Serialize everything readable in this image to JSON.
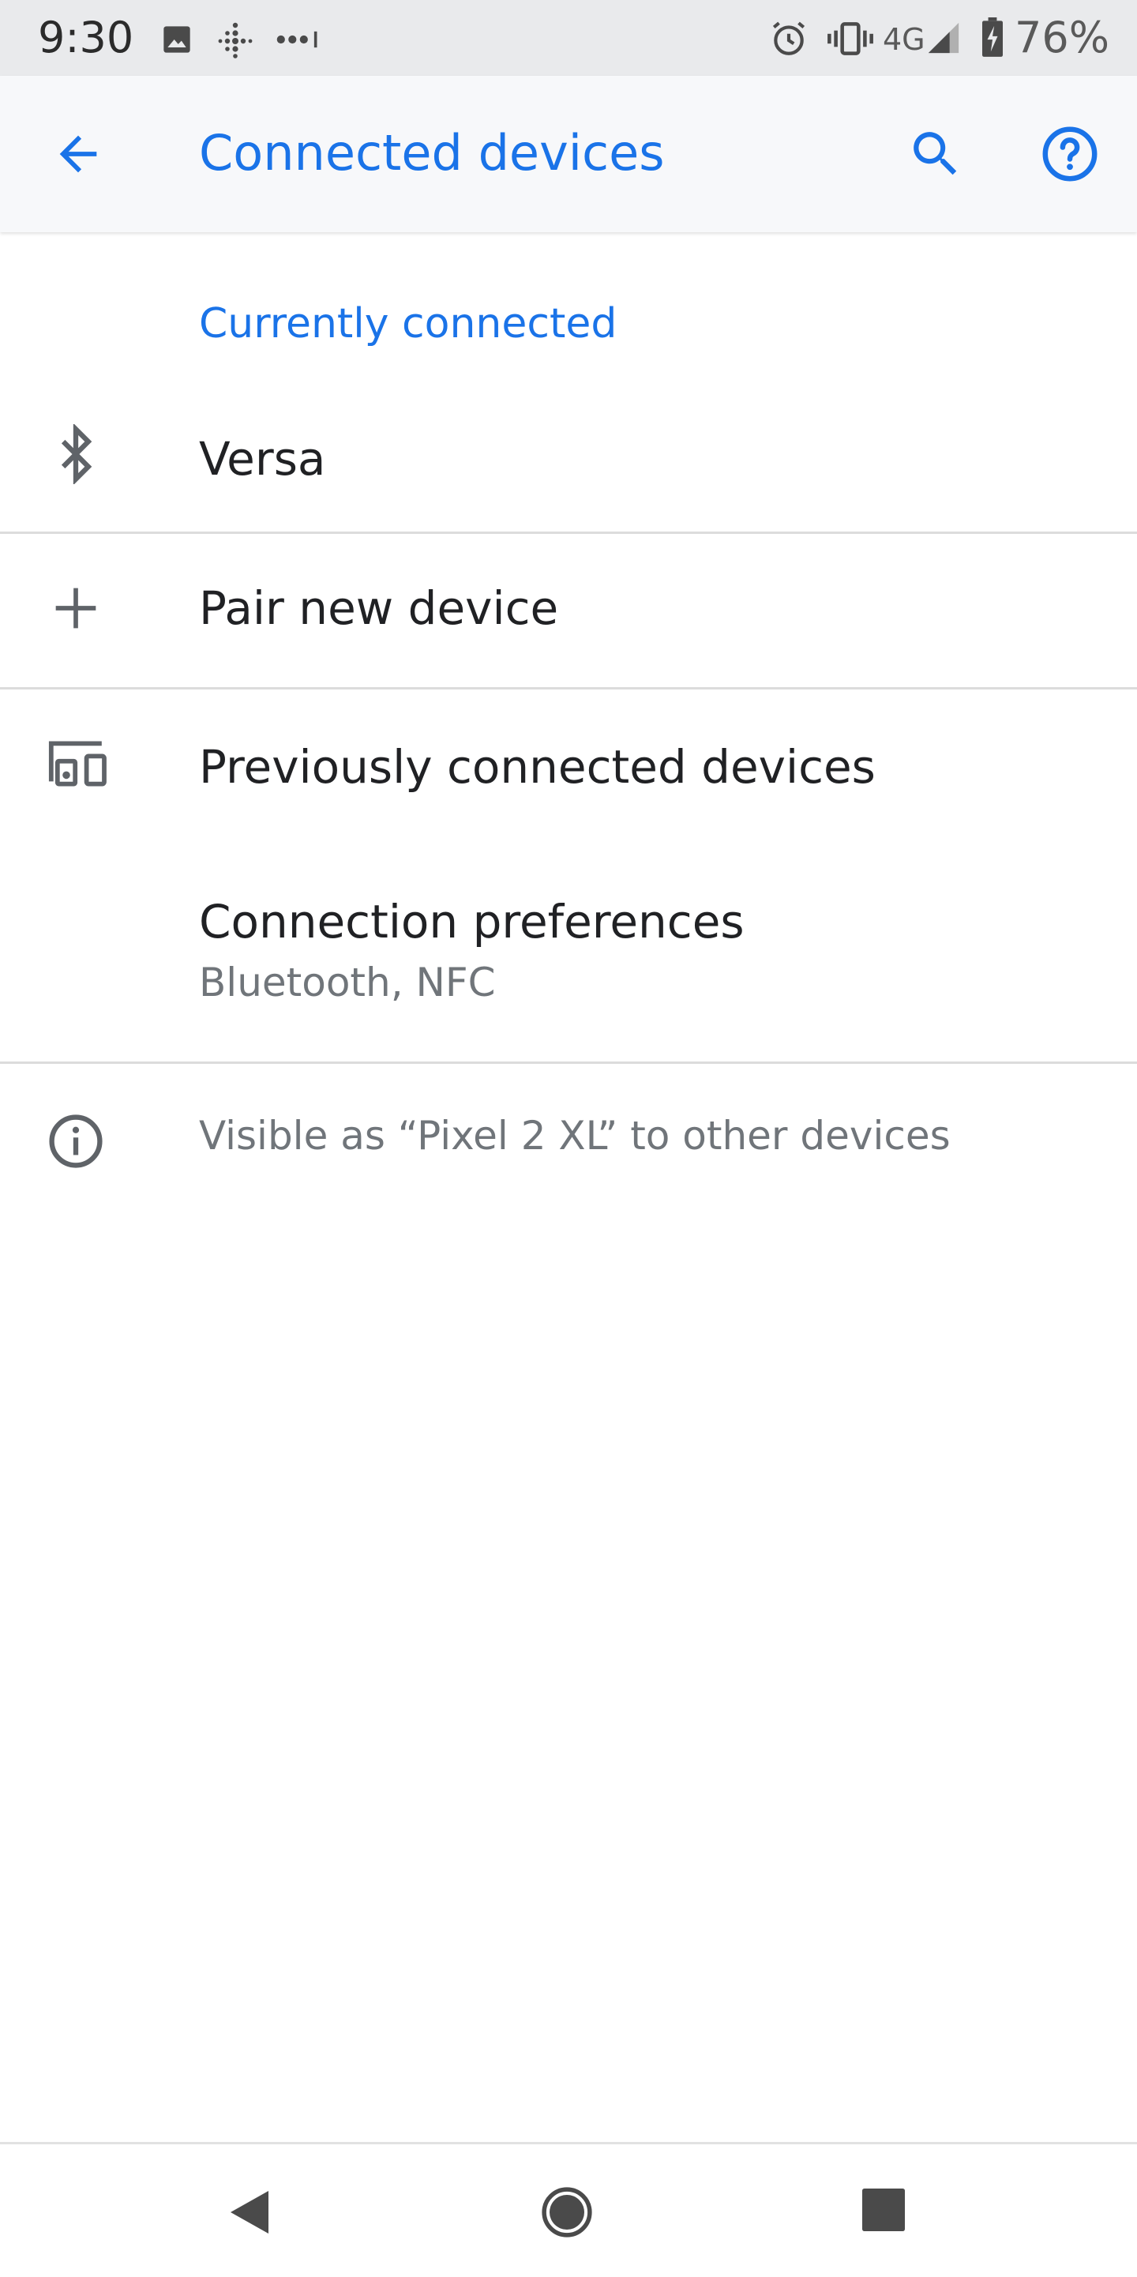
{
  "status_bar": {
    "time": "9:30",
    "network": "4G",
    "battery": "76%",
    "icons": [
      "image-icon",
      "fitbit-icon",
      "more-dots-icon",
      "alarm-icon",
      "vibrate-icon",
      "signal-icon",
      "battery-charging-icon"
    ]
  },
  "app_bar": {
    "title": "Connected devices",
    "back_icon": "arrow-back-icon",
    "search_icon": "search-icon",
    "help_icon": "help-icon"
  },
  "sections": {
    "currently_connected": "Currently connected"
  },
  "items": [
    {
      "label": "Versa",
      "icon": "bluetooth-icon"
    },
    {
      "label": "Pair new device",
      "icon": "plus-icon"
    },
    {
      "label": "Previously connected devices",
      "icon": "devices-icon"
    },
    {
      "label": "Connection preferences",
      "sublabel": "Bluetooth, NFC"
    }
  ],
  "footer": {
    "text": "Visible as “Pixel 2 XL” to other devices",
    "icon": "info-icon"
  },
  "nav_bar": {
    "icons": [
      "back-triangle-icon",
      "home-circle-icon",
      "recents-square-icon"
    ]
  },
  "colors": {
    "accent": "#1a73e8",
    "text_primary": "#202124",
    "text_secondary": "#70757a",
    "icon": "#5f6368"
  }
}
